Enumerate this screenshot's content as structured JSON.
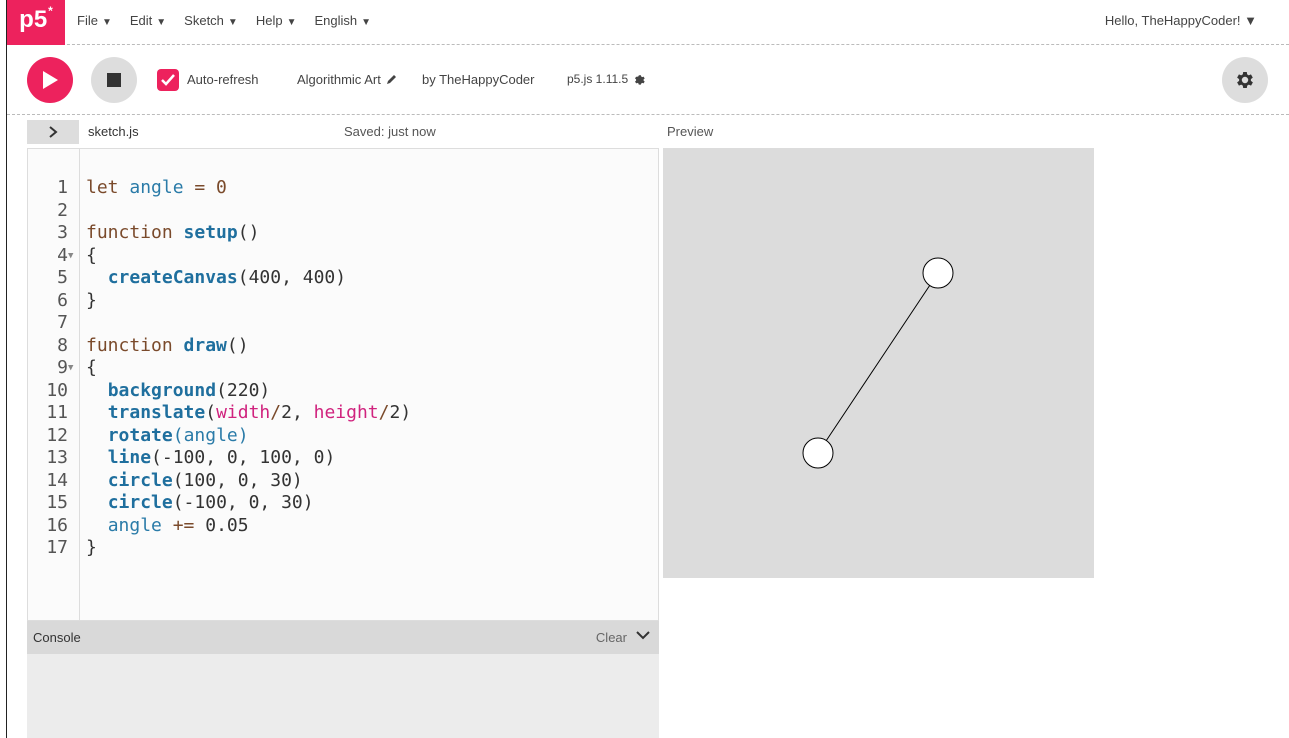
{
  "nav": {
    "logo": "p5",
    "logo_sup": "*",
    "menu": [
      {
        "label": "File",
        "caret": "▼"
      },
      {
        "label": "Edit",
        "caret": "▼"
      },
      {
        "label": "Sketch",
        "caret": "▼"
      },
      {
        "label": "Help",
        "caret": "▼"
      },
      {
        "label": "English",
        "caret": "▼"
      }
    ],
    "user": "Hello, TheHappyCoder! ▼"
  },
  "toolbar": {
    "auto_refresh_label": "Auto-refresh",
    "auto_refresh_checked": true,
    "sketch_name": "Algorithmic Art",
    "by_label": "by TheHappyCoder",
    "version": "p5.js 1.11.5"
  },
  "editor": {
    "toggle_icon": "chevron-right",
    "filename": "sketch.js",
    "saved_status": "Saved: just now",
    "lines": [
      {
        "n": "1",
        "fold": ""
      },
      {
        "n": "2",
        "fold": ""
      },
      {
        "n": "3",
        "fold": ""
      },
      {
        "n": "4",
        "fold": "▼"
      },
      {
        "n": "5",
        "fold": ""
      },
      {
        "n": "6",
        "fold": ""
      },
      {
        "n": "7",
        "fold": ""
      },
      {
        "n": "8",
        "fold": ""
      },
      {
        "n": "9",
        "fold": "▼"
      },
      {
        "n": "10",
        "fold": ""
      },
      {
        "n": "11",
        "fold": ""
      },
      {
        "n": "12",
        "fold": ""
      },
      {
        "n": "13",
        "fold": ""
      },
      {
        "n": "14",
        "fold": ""
      },
      {
        "n": "15",
        "fold": ""
      },
      {
        "n": "16",
        "fold": ""
      },
      {
        "n": "17",
        "fold": ""
      }
    ],
    "code": {
      "l1_kw": "let",
      "l1_var": "angle",
      "l1_rest": " = 0",
      "l3_kw": "function",
      "l3_fn": "setup",
      "l3_rest": "()",
      "l4": "{",
      "l5_fn": "createCanvas",
      "l5_rest": "(400, 400)",
      "l6": "}",
      "l8_kw": "function",
      "l8_fn": "draw",
      "l8_rest": "()",
      "l9": "{",
      "l10_fn": "background",
      "l10_rest": "(220)",
      "l11_fn": "translate",
      "l11_a": "(",
      "l11_b1": "width",
      "l11_op1": "/",
      "l11_c": "2, ",
      "l11_b2": "height",
      "l11_op2": "/",
      "l11_d": "2)",
      "l12_fn": "rotate",
      "l12_a": "(",
      "l12_var": "angle",
      "l12_b": ")",
      "l13_fn": "line",
      "l13_rest": "(-100, 0, 100, 0)",
      "l14_fn": "circle",
      "l14_rest": "(100, 0, 30)",
      "l15_fn": "circle",
      "l15_rest": "(-100, 0, 30)",
      "l16_var": "angle",
      "l16_op": " +=",
      "l16_rest": " 0.05",
      "l17": "}"
    }
  },
  "preview": {
    "label": "Preview",
    "background": "#dcdcdc"
  },
  "console": {
    "title": "Console",
    "clear_label": "Clear"
  },
  "colors": {
    "accent": "#ed225d",
    "keyword": "#7a4a2b",
    "function": "#1f6f9e",
    "variable": "#2a7ba8",
    "builtin": "#d0237e"
  }
}
